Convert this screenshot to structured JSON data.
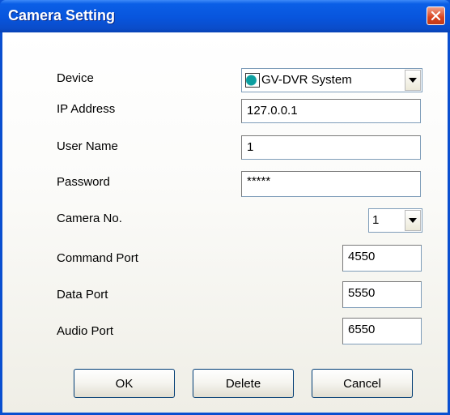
{
  "window": {
    "title": "Camera Setting",
    "close_icon": "close-x-icon"
  },
  "form": {
    "device": {
      "label": "Device",
      "value": "GV-DVR System",
      "icon": "gv-logo-icon"
    },
    "ip_address": {
      "label": "IP Address",
      "value": "127.0.0.1"
    },
    "user_name": {
      "label": "User Name",
      "value": "1"
    },
    "password": {
      "label": "Password",
      "value": "*****"
    },
    "camera_no": {
      "label": "Camera No.",
      "value": "1"
    },
    "command_port": {
      "label": "Command Port",
      "value": "4550"
    },
    "data_port": {
      "label": "Data Port",
      "value": "5550"
    },
    "audio_port": {
      "label": "Audio Port",
      "value": "6550"
    }
  },
  "buttons": {
    "ok": "OK",
    "delete": "Delete",
    "cancel": "Cancel"
  },
  "colors": {
    "titlebar": "#0855dd",
    "close_button": "#d8431f",
    "field_border": "#7f9db9"
  }
}
